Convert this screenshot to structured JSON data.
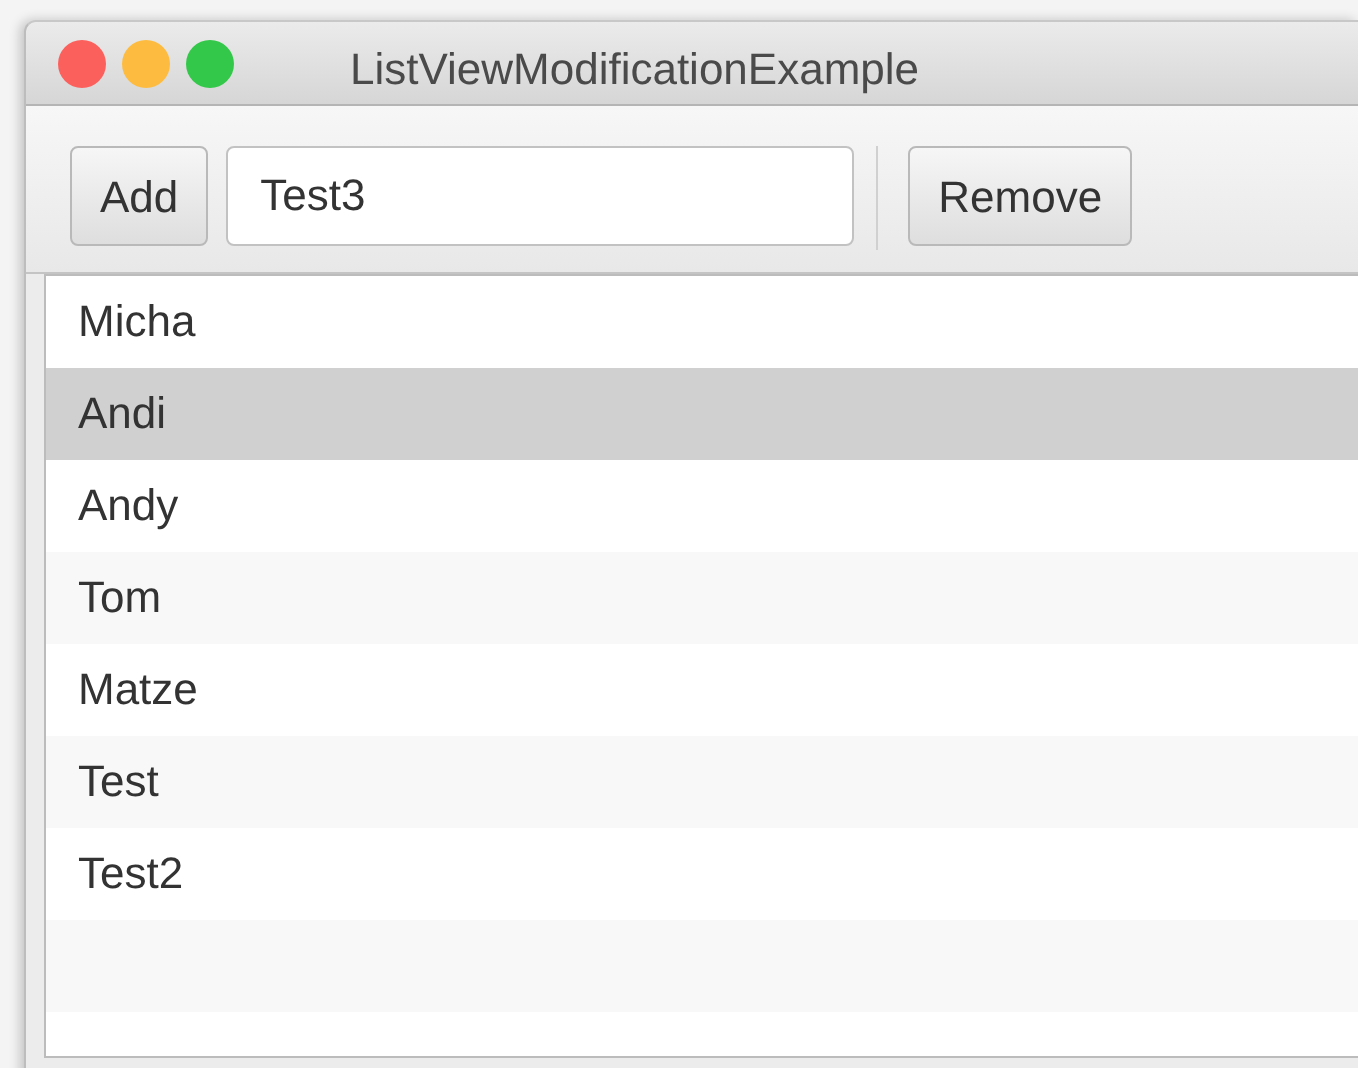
{
  "window": {
    "title": "ListViewModificationExample"
  },
  "toolbar": {
    "add_button": "Add",
    "input": {
      "value": "Test3"
    },
    "remove_button": "Remove"
  },
  "list": {
    "items": [
      {
        "label": "Micha",
        "selected": false
      },
      {
        "label": "Andi",
        "selected": true
      },
      {
        "label": "Andy",
        "selected": false
      },
      {
        "label": "Tom",
        "selected": false
      },
      {
        "label": "Matze",
        "selected": false
      },
      {
        "label": "Test",
        "selected": false
      },
      {
        "label": "Test2",
        "selected": false
      }
    ]
  }
}
